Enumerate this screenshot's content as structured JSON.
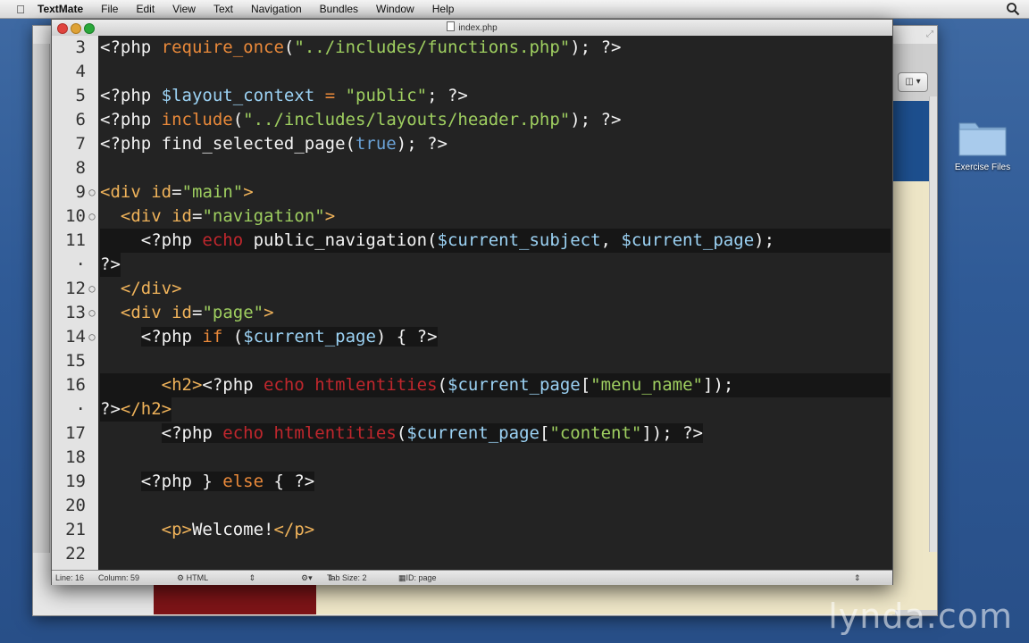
{
  "menubar": {
    "app": "TextMate",
    "items": [
      "File",
      "Edit",
      "View",
      "Text",
      "Navigation",
      "Bundles",
      "Window",
      "Help"
    ]
  },
  "window": {
    "title": "index.php"
  },
  "desktop": {
    "icon_label": "Exercise Files"
  },
  "editor": {
    "lines": [
      {
        "n": "3",
        "fold": ""
      },
      {
        "n": "4",
        "fold": ""
      },
      {
        "n": "5",
        "fold": ""
      },
      {
        "n": "6",
        "fold": ""
      },
      {
        "n": "7",
        "fold": ""
      },
      {
        "n": "8",
        "fold": ""
      },
      {
        "n": "9",
        "fold": "○"
      },
      {
        "n": "10",
        "fold": "○"
      },
      {
        "n": "11",
        "fold": ""
      },
      {
        "n": "·",
        "fold": ""
      },
      {
        "n": "12",
        "fold": "○"
      },
      {
        "n": "13",
        "fold": "○"
      },
      {
        "n": "14",
        "fold": "○"
      },
      {
        "n": "15",
        "fold": ""
      },
      {
        "n": "16",
        "fold": ""
      },
      {
        "n": "·",
        "fold": ""
      },
      {
        "n": "17",
        "fold": ""
      },
      {
        "n": "18",
        "fold": ""
      },
      {
        "n": "19",
        "fold": ""
      },
      {
        "n": "20",
        "fold": ""
      },
      {
        "n": "21",
        "fold": ""
      },
      {
        "n": "22",
        "fold": ""
      }
    ]
  },
  "statusbar": {
    "line": "Line: 16",
    "column": "Column: 59",
    "language": "HTML",
    "tab_size": "Tab Size:  2",
    "symbol": "ID: page"
  },
  "watermark": "lynda.com",
  "colors": {
    "tag": "#f0b35a",
    "string": "#9fcf60",
    "variable": "#9cd3f5",
    "function": "#e9893a",
    "echo": "#c0272d"
  }
}
